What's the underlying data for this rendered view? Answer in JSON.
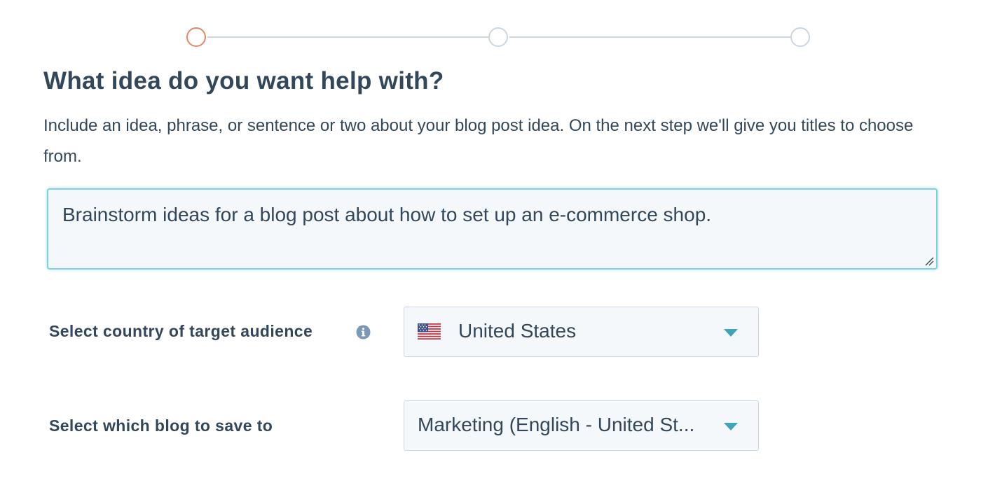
{
  "stepper": {
    "steps": [
      "step-1",
      "step-2",
      "step-3"
    ],
    "active_step": 1,
    "active_color": "#e8866a",
    "inactive_color": "#cbd6e2"
  },
  "header": {
    "title": "What idea do you want help with?",
    "description": "Include an idea, phrase, or sentence or two about your blog post idea. On the next step we'll give you titles to choose from."
  },
  "idea_input": {
    "value": "Brainstorm ideas for a blog post about how to set up an e-commerce shop.",
    "focus_color": "#7fd1de"
  },
  "country": {
    "label": "Select country of target audience",
    "info_icon": "info-icon",
    "flag_icon": "us-flag-icon",
    "value": "United States",
    "caret_icon": "caret-down-icon"
  },
  "blog": {
    "label": "Select which blog to save to",
    "value": "Marketing (English - United St...",
    "caret_icon": "caret-down-icon"
  },
  "colors": {
    "text": "#33475b",
    "field_bg": "#f5f8fa",
    "caret": "#3fa4b9"
  }
}
